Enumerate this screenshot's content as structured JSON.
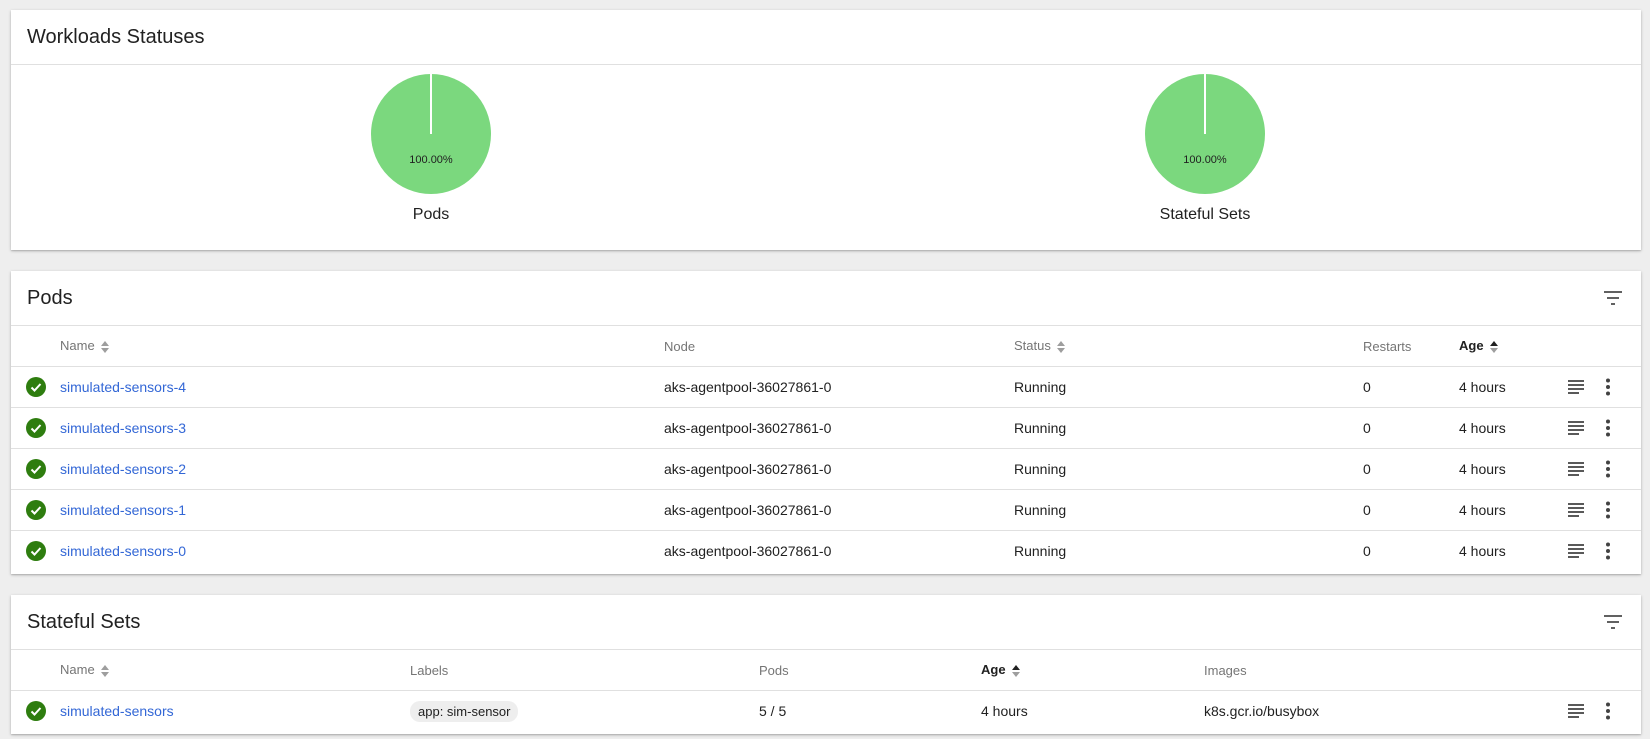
{
  "workloads": {
    "title": "Workloads Statuses",
    "charts": [
      {
        "label": "Pods",
        "percent_text": "100.00%",
        "running_fraction": 1.0
      },
      {
        "label": "Stateful Sets",
        "percent_text": "100.00%",
        "running_fraction": 1.0
      }
    ]
  },
  "pods": {
    "title": "Pods",
    "columns": {
      "name": "Name",
      "node": "Node",
      "status": "Status",
      "restarts": "Restarts",
      "age": "Age"
    },
    "rows": [
      {
        "name": "simulated-sensors-4",
        "node": "aks-agentpool-36027861-0",
        "status": "Running",
        "restarts": "0",
        "age": "4 hours"
      },
      {
        "name": "simulated-sensors-3",
        "node": "aks-agentpool-36027861-0",
        "status": "Running",
        "restarts": "0",
        "age": "4 hours"
      },
      {
        "name": "simulated-sensors-2",
        "node": "aks-agentpool-36027861-0",
        "status": "Running",
        "restarts": "0",
        "age": "4 hours"
      },
      {
        "name": "simulated-sensors-1",
        "node": "aks-agentpool-36027861-0",
        "status": "Running",
        "restarts": "0",
        "age": "4 hours"
      },
      {
        "name": "simulated-sensors-0",
        "node": "aks-agentpool-36027861-0",
        "status": "Running",
        "restarts": "0",
        "age": "4 hours"
      }
    ]
  },
  "statefulsets": {
    "title": "Stateful Sets",
    "columns": {
      "name": "Name",
      "labels": "Labels",
      "pods": "Pods",
      "age": "Age",
      "images": "Images"
    },
    "rows": [
      {
        "name": "simulated-sensors",
        "label": "app: sim-sensor",
        "pods": "5 / 5",
        "age": "4 hours",
        "image": "k8s.gcr.io/busybox"
      }
    ]
  },
  "colors": {
    "pie_running": "#7bd87e",
    "status_ok": "#2e7d0f",
    "link": "#3367d6"
  },
  "icons": {
    "filter": "filter-list-icon",
    "status": "check-circle-icon",
    "logs": "logs-icon",
    "menu": "more-vert-icon",
    "sort": "sort-icon"
  }
}
